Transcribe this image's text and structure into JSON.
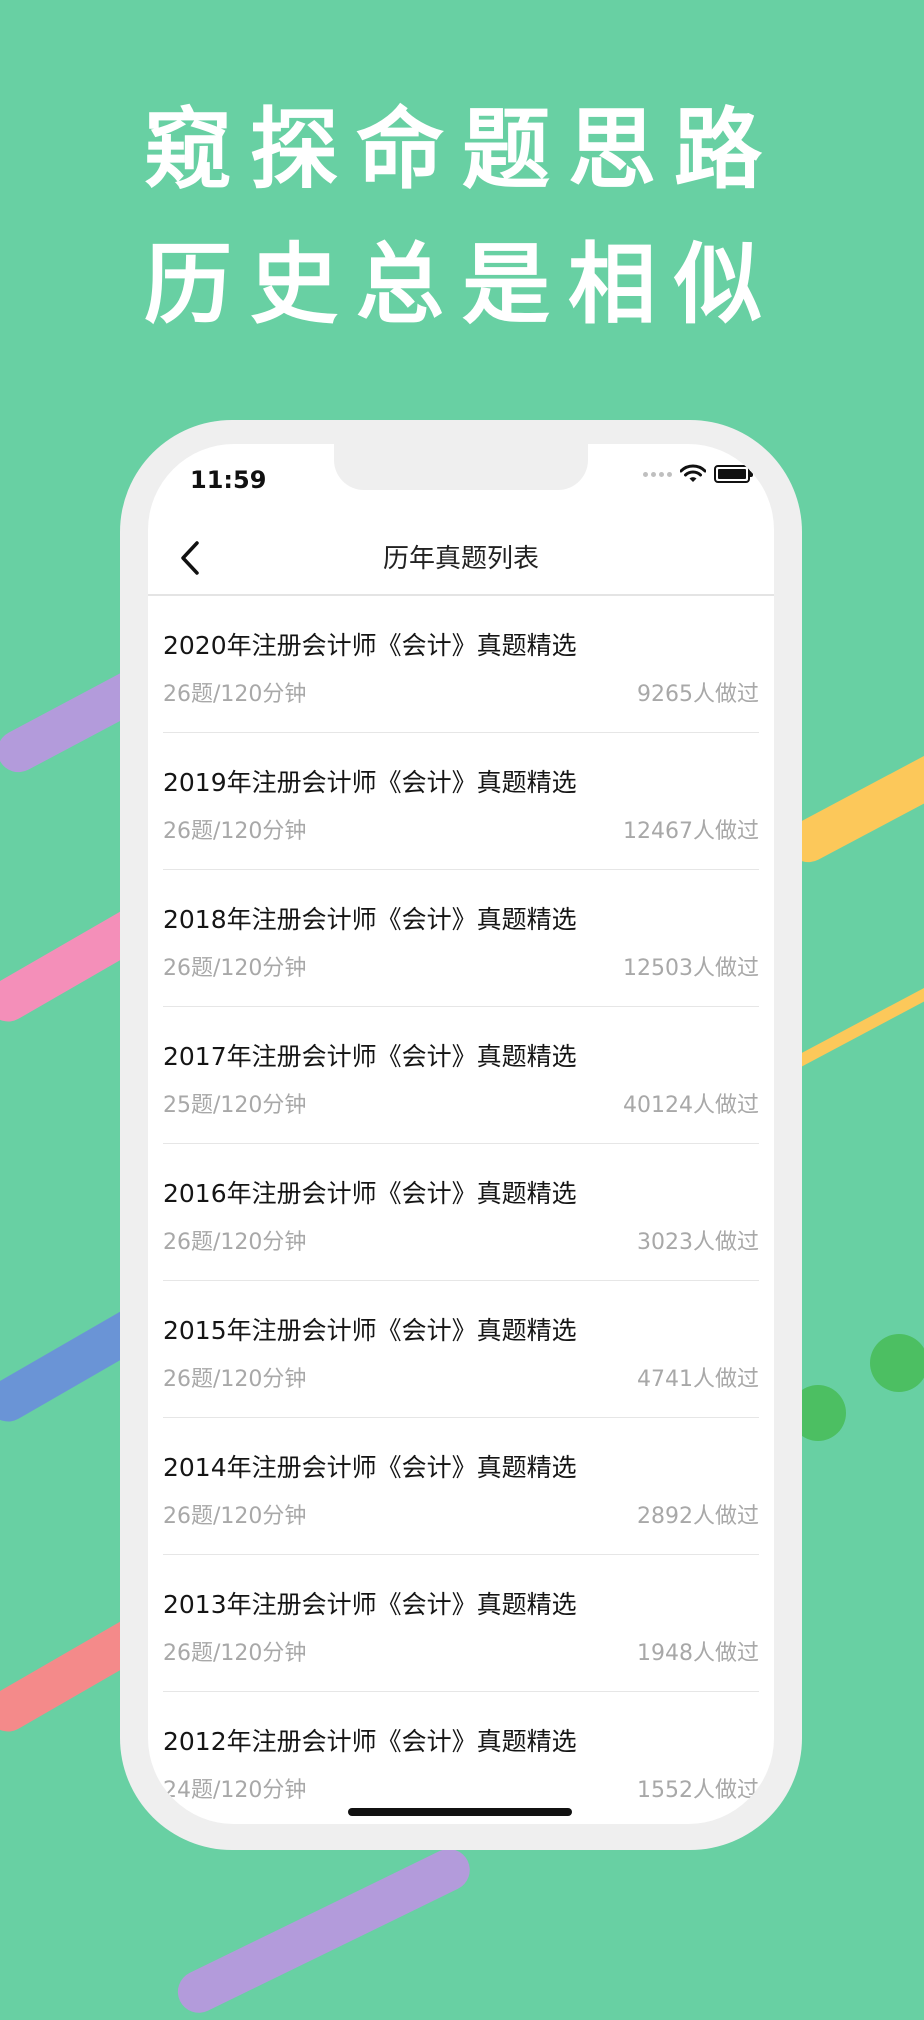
{
  "headline": {
    "line1": "窥探命题思路",
    "line2": "历史总是相似"
  },
  "status_bar": {
    "time": "11:59"
  },
  "nav": {
    "title": "历年真题列表"
  },
  "items": [
    {
      "title": "2020年注册会计师《会计》真题精选",
      "meta": "26题/120分钟",
      "count": "9265人做过"
    },
    {
      "title": "2019年注册会计师《会计》真题精选",
      "meta": "26题/120分钟",
      "count": "12467人做过"
    },
    {
      "title": "2018年注册会计师《会计》真题精选",
      "meta": "26题/120分钟",
      "count": "12503人做过"
    },
    {
      "title": "2017年注册会计师《会计》真题精选",
      "meta": "25题/120分钟",
      "count": "40124人做过"
    },
    {
      "title": "2016年注册会计师《会计》真题精选",
      "meta": "26题/120分钟",
      "count": "3023人做过"
    },
    {
      "title": "2015年注册会计师《会计》真题精选",
      "meta": "26题/120分钟",
      "count": "4741人做过"
    },
    {
      "title": "2014年注册会计师《会计》真题精选",
      "meta": "26题/120分钟",
      "count": "2892人做过"
    },
    {
      "title": "2013年注册会计师《会计》真题精选",
      "meta": "26题/120分钟",
      "count": "1948人做过"
    },
    {
      "title": "2012年注册会计师《会计》真题精选",
      "meta": "24题/120分钟",
      "count": "1552人做过"
    }
  ],
  "colors": {
    "background": "#68d0a3",
    "stripe_purple": "#b39bdb",
    "stripe_pink": "#f48fb9",
    "stripe_blue": "#6a94d6",
    "stripe_red": "#f48a8a",
    "stripe_yellow": "#fcc85a",
    "dot_green": "#4cbf62"
  }
}
